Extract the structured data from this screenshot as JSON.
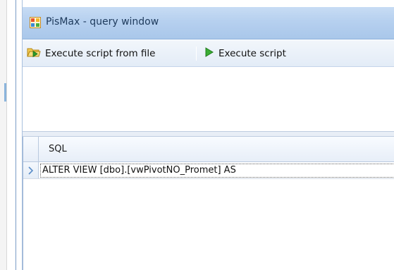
{
  "window": {
    "title": "PisMax - query window"
  },
  "toolbar": {
    "execute_from_file_label": "Execute script from file",
    "execute_label": "Execute script"
  },
  "grid": {
    "columns": [
      "SQL"
    ],
    "rows": [
      {
        "sql": "ALTER VIEW [dbo].[vwPivotNO_Promet] AS"
      }
    ]
  },
  "icons": {
    "app": "app-grid-icon",
    "open_file": "folder-play-icon",
    "execute": "play-icon",
    "row_indicator": "row-pointer-icon"
  },
  "colors": {
    "titlebar": "#b6d0ef",
    "play_green": "#2e9e2a",
    "folder_yellow": "#e8b83a"
  }
}
